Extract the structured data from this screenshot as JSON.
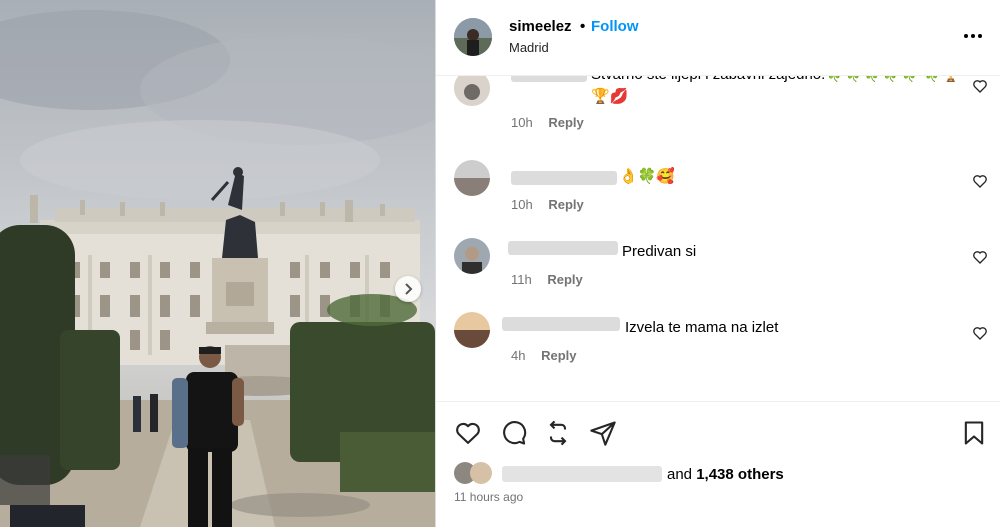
{
  "header": {
    "username": "simeelez",
    "separator": "•",
    "follow_label": "Follow",
    "location": "Madrid",
    "more_icon": "more-options-icon"
  },
  "comments": [
    {
      "text": "Stvarno ste lijepi i zabavni zajedno.🍀🍀🍀🍀🍀 🍀🏆🏆💋",
      "time": "10h",
      "reply": "Reply"
    },
    {
      "text": "👌🍀🥰",
      "time": "10h",
      "reply": "Reply"
    },
    {
      "text": "Predivan si",
      "time": "11h",
      "reply": "Reply"
    },
    {
      "text": "Izvela te mama na izlet",
      "time": "4h",
      "reply": "Reply"
    }
  ],
  "likes": {
    "and": "and",
    "count": "1,438 others"
  },
  "timestamp": "11 hours ago",
  "colors": {
    "accent": "#0095f6",
    "muted": "#737373"
  }
}
